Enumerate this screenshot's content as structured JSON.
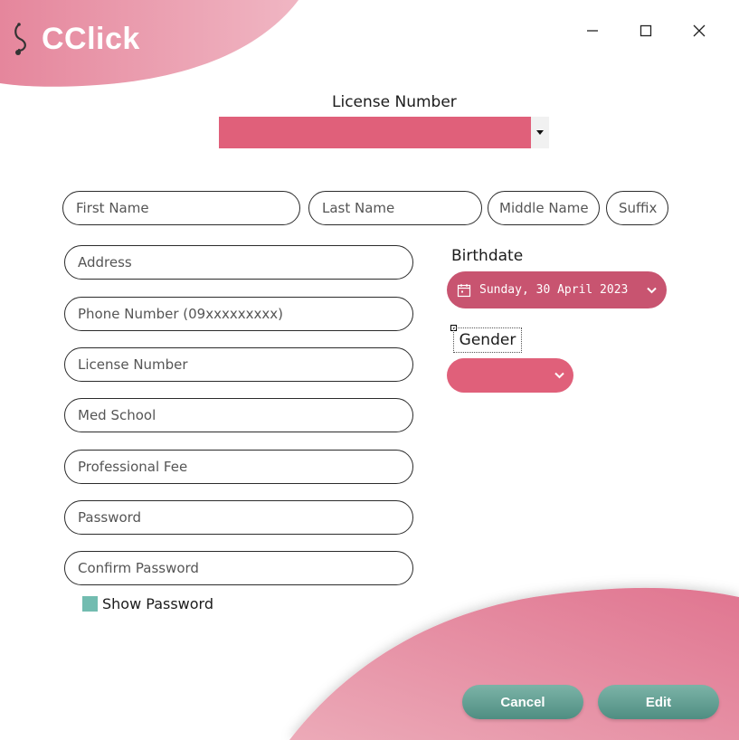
{
  "app": {
    "logo_text": "CClick"
  },
  "window_controls": {
    "minimize": "minimize-icon",
    "maximize": "maximize-icon",
    "close": "close-icon"
  },
  "license_selector": {
    "label": "License Number",
    "value": ""
  },
  "name_fields": {
    "first_name": "First Name",
    "last_name": "Last Name",
    "middle_name": "Middle Name",
    "suffix": "Suffix"
  },
  "fields": {
    "address": "Address",
    "phone": "Phone Number (09xxxxxxxxx)",
    "license": "License Number",
    "med_school": "Med School",
    "professional_fee": "Professional Fee",
    "password": "Password",
    "confirm_password": "Confirm Password"
  },
  "show_password": {
    "label": "Show Password"
  },
  "birthdate": {
    "label": "Birthdate",
    "value": "Sunday, 30 April 2023"
  },
  "gender": {
    "label": "Gender",
    "value": ""
  },
  "buttons": {
    "cancel": "Cancel",
    "edit": "Edit"
  },
  "colors": {
    "accent_pink": "#e0607a",
    "date_pink": "#c85470",
    "button_teal": "#5f9d91",
    "checkbox_teal": "#72bcb0"
  }
}
